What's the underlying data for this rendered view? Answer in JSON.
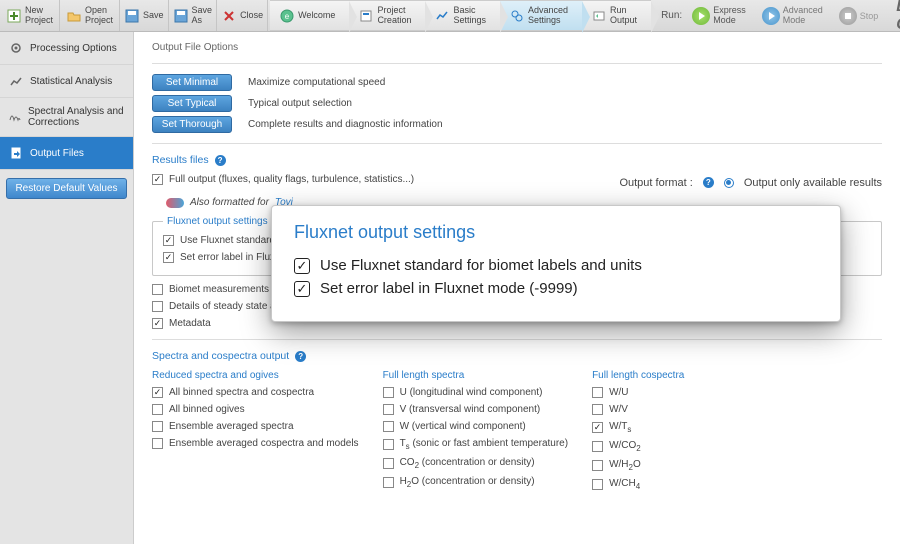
{
  "brand": "LI-COR",
  "toolbar": {
    "new_project": "New\nProject",
    "open_project": "Open\nProject",
    "save": "Save",
    "save_as": "Save\nAs",
    "close": "Close"
  },
  "wizard": {
    "tabs": [
      {
        "label": "Welcome"
      },
      {
        "label": "Project\nCreation"
      },
      {
        "label": "Basic\nSettings"
      },
      {
        "label": "Advanced\nSettings"
      },
      {
        "label": "Run\nOutput"
      }
    ],
    "active_index": 3
  },
  "run": {
    "label": "Run:",
    "express": "Express\nMode",
    "advanced": "Advanced\nMode",
    "stop": "Stop"
  },
  "sidebar": {
    "items": [
      {
        "label": "Processing Options"
      },
      {
        "label": "Statistical Analysis"
      },
      {
        "label": "Spectral Analysis and Corrections"
      },
      {
        "label": "Output Files"
      }
    ],
    "active_index": 3,
    "restore": "Restore Default Values"
  },
  "output_file_options": {
    "title": "Output File Options",
    "presets": [
      {
        "button": "Set Minimal",
        "desc": "Maximize computational speed"
      },
      {
        "button": "Set Typical",
        "desc": "Typical output selection"
      },
      {
        "button": "Set Thorough",
        "desc": "Complete results and diagnostic information"
      }
    ]
  },
  "results_files": {
    "title": "Results files",
    "full_output": {
      "label": "Full output (fluxes, quality flags, turbulence, statistics...)",
      "checked": true
    },
    "output_format_label": "Output format :",
    "output_only": "Output only available results",
    "also_formatted_prefix": "Also formatted for ",
    "tovi": "Tovi",
    "fluxnet_fieldset_legend": "Fluxnet output settings",
    "fluxnet_use_standard": {
      "label": "Use Fluxnet standard for bi",
      "checked": true
    },
    "fluxnet_error_label": {
      "label": "Set error label in Fluxnet m",
      "checked": true
    },
    "biomet": {
      "label": "Biomet measurements (avera",
      "checked": false
    },
    "steady_state": {
      "label": "Details of steady state and developed turbulence tests (Foken et al. 2004)",
      "checked": false
    },
    "metadata": {
      "label": "Metadata",
      "checked": true
    }
  },
  "spectra": {
    "title": "Spectra and cospectra output",
    "col1": {
      "header": "Reduced spectra and ogives",
      "items": [
        {
          "label": "All binned spectra and cospectra",
          "checked": true
        },
        {
          "label": "All binned ogives",
          "checked": false
        },
        {
          "label": "Ensemble averaged spectra",
          "checked": false
        },
        {
          "label": "Ensemble averaged cospectra and models",
          "checked": false
        }
      ]
    },
    "col2": {
      "header": "Full length spectra",
      "items": [
        {
          "label": "U (longitudinal wind component)",
          "checked": false
        },
        {
          "label": "V (transversal wind component)",
          "checked": false
        },
        {
          "label": "W (vertical wind component)",
          "checked": false
        },
        {
          "label": "Ts (sonic or fast ambient temperature)",
          "checked": false
        },
        {
          "label": "CO2 (concentration or density)",
          "checked": false
        },
        {
          "label": "H2O (concentration or density)",
          "checked": false
        }
      ]
    },
    "col3": {
      "header": "Full length cospectra",
      "items": [
        {
          "label": "W/U",
          "checked": false
        },
        {
          "label": "W/V",
          "checked": false
        },
        {
          "label": "W/Ts",
          "checked": true
        },
        {
          "label": "W/CO2",
          "checked": false
        },
        {
          "label": "W/H2O",
          "checked": false
        },
        {
          "label": "W/CH4",
          "checked": false
        }
      ]
    }
  },
  "callout": {
    "title": "Fluxnet output settings",
    "row1": "Use Fluxnet standard for biomet labels and units",
    "row2": "Set error label in Fluxnet mode (-9999)"
  }
}
